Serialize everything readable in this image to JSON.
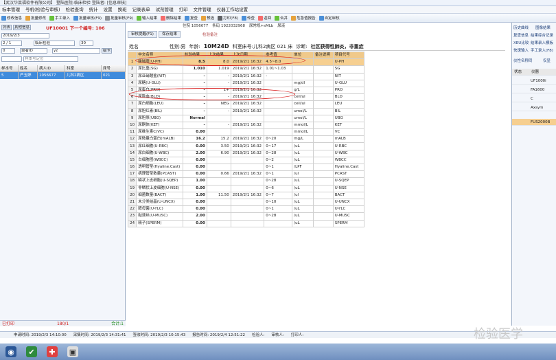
{
  "window": {
    "title": "【武汉华莱福软件有限公司】 登陆医院:临床检验 登陆者: [信息审核]"
  },
  "menu": [
    "标本管理",
    "号机(检验与审核)",
    "检验查询",
    "统计",
    "设置",
    "换班",
    "记录表单",
    "试剂管理",
    "打印",
    "文件管理",
    "仪器工作站设置"
  ],
  "toolbar": [
    "修改信息",
    "批量修改",
    "手工录入",
    "批量审核(F9)",
    "批量审核(F9)",
    "输入结果",
    "删除结果",
    "复查",
    "预选",
    "打印(F8)",
    "传查",
    "返回",
    "合并",
    "危急值报告",
    "自定审核"
  ],
  "left": {
    "tabs": [
      "列表",
      "其他信息"
    ],
    "barcode": "UF10001 下一个编号: 106",
    "date": "2019/2/3",
    "row2": [
      "2 / 1",
      "临床检验",
      "30"
    ],
    "row3": [
      "0",
      "患者ID",
      "yz",
      "级卡"
    ],
    "search_placeholder": "样本号定位",
    "headers": [
      "样本号",
      "姓名",
      "病人ID",
      "科室",
      "床号"
    ],
    "row": [
      "5",
      "严玉婷",
      "1056677",
      "儿科2病区",
      "021"
    ],
    "status_left": "已打印",
    "status_mid": "180/1",
    "status_right": "合计:1"
  },
  "main": {
    "tabs": [
      "审核提醒(F1)",
      "保存结果"
    ],
    "info": [
      "住院 1056677",
      "条码 1922032968",
      "尿常规+sMLb",
      "尿液"
    ],
    "note": "检验备注",
    "patient": {
      "label": "姓名",
      "sex": "性别:男",
      "age_label": "年龄:",
      "age": "10M24D",
      "dept": "科室床号:儿科2病区 021 床",
      "diag_label": "诊断:",
      "diag": "社区获得性肺炎，非重症"
    },
    "headers": [
      "",
      "中文名称",
      "检验结果",
      "上次结果",
      "上次日期",
      "参考值",
      "单位",
      "备注说明",
      "项目代号"
    ],
    "rows": [
      [
        "1",
        "酸碱度(U-PH)",
        "8.5",
        "8.0",
        "2019/2/1 16:32",
        "4.5~8.0",
        "",
        "",
        "U-PH"
      ],
      [
        "2",
        "尿比重(SG)",
        "1.010",
        "1.019",
        "2019/2/1 16:32",
        "1.01~1.03",
        "",
        "",
        "SG"
      ],
      [
        "3",
        "尿亚硝酸盐(NIT)",
        "-",
        "-",
        "2019/2/1 16:32",
        "-",
        "",
        "",
        "NIT"
      ],
      [
        "4",
        "尿糖(U-GLU)",
        "-",
        "-",
        "2019/2/1 16:32",
        "",
        "mg/dl",
        "",
        "U-GLU"
      ],
      [
        "5",
        "尿蛋白(PRO)",
        "-",
        "1+",
        "2019/2/1 16:32",
        "",
        "g/L",
        "",
        "PRO"
      ],
      [
        "6",
        "尿隐血(BLD)",
        "-",
        "-",
        "2019/2/1 16:32",
        "",
        "cell/ul",
        "",
        "BLD"
      ],
      [
        "7",
        "尿白细胞(LEU)",
        "-",
        "NEG",
        "2019/2/1 16:32",
        "",
        "cell/ul",
        "",
        "LEU"
      ],
      [
        "8",
        "尿胆红素(BIL)",
        "-",
        "-",
        "2019/2/1 16:32",
        "",
        "umol/L",
        "",
        "BIL"
      ],
      [
        "9",
        "尿胆原(UBG)",
        "Normal",
        "",
        "",
        "",
        "umol/L",
        "",
        "UBG"
      ],
      [
        "10",
        "尿酮体(KET)",
        "-",
        "-",
        "2019/2/1 16:32",
        "",
        "mmol/L",
        "",
        "KET"
      ],
      [
        "11",
        "尿维生素C(VC)",
        "0.00",
        "",
        "",
        "",
        "mmol/L",
        "",
        "VC"
      ],
      [
        "12",
        "尿微量白蛋白(mALB)",
        "16.2",
        "15.2",
        "2019/2/1 16:32",
        "0~20",
        "mg/L",
        "",
        "mALB"
      ],
      [
        "13",
        "尿红细胞(U-RBC)",
        "0.00",
        "3.50",
        "2019/2/1 16:32",
        "0~17",
        "/uL",
        "",
        "U-RBC"
      ],
      [
        "14",
        "尿白细胞(U-WBC)",
        "2.00",
        "6.90",
        "2019/2/1 16:32",
        "0~28",
        "/uL",
        "",
        "U-WBC"
      ],
      [
        "15",
        "白细胞团(WBCC)",
        "0.00",
        "",
        "",
        "0~2",
        "/uL",
        "",
        "WBCC"
      ],
      [
        "16",
        "透明管型(Hyaline.Cast)",
        "0.00",
        "",
        "",
        "0~1",
        "/LPF",
        "",
        "Hyaline.Cast"
      ],
      [
        "17",
        "病理管型数量(PCAST)",
        "0.00",
        "0.66",
        "2019/2/1 16:32",
        "0~1",
        "/ul",
        "",
        "PCAST"
      ],
      [
        "18",
        "鳞状上皮细胞(U-SQEP)",
        "1.00",
        "",
        "",
        "0~28",
        "/uL",
        "",
        "U-SQEP"
      ],
      [
        "19",
        "非鳞状上皮细胞(U-NSE)",
        "0.00",
        "",
        "",
        "0~6",
        "/uL",
        "",
        "U-NSE"
      ],
      [
        "20",
        "细菌数量(BACT)",
        "1.00",
        "11.50",
        "2019/2/1 16:32",
        "0~7",
        "/ul",
        "",
        "BACT"
      ],
      [
        "21",
        "未分类结晶(U-UNCX)",
        "0.00",
        "",
        "",
        "0~10",
        "/uL",
        "",
        "U-UNCX"
      ],
      [
        "22",
        "酵母菌(U-YLC)",
        "0.00",
        "",
        "",
        "0~1",
        "/uL",
        "",
        "U-YLC"
      ],
      [
        "23",
        "黏液丝(U-MUSC)",
        "2.00",
        "",
        "",
        "0~28",
        "/uL",
        "",
        "U-MUSC"
      ],
      [
        "24",
        "精子(SPERM)",
        "0.00",
        "",
        "",
        "",
        "/uL",
        "",
        "SPERM"
      ]
    ]
  },
  "right": {
    "buttons": [
      "历史曲线",
      "图像结果",
      "复查信息",
      "结果综合记录",
      "XEU比较",
      "结果录入模板",
      "快速输入",
      "手工录入(F8)",
      "仪性名称同",
      "仅显"
    ],
    "table_headers": [
      "状态",
      "仪器"
    ],
    "items": [
      "UF1000i",
      "FA1600",
      "C",
      "Axsym",
      "FUS2000B"
    ]
  },
  "bottom": [
    "申请时间: 2019/2/3 14:10:00",
    "采集时间: 2019/2/3 14:31:41",
    "签收时间: 2019/2/3 10:15:43",
    "报告时间: 2019/2/4 12:51:22",
    "检验人:",
    "审核人:",
    "打印人:"
  ],
  "watermark": "检验医学"
}
